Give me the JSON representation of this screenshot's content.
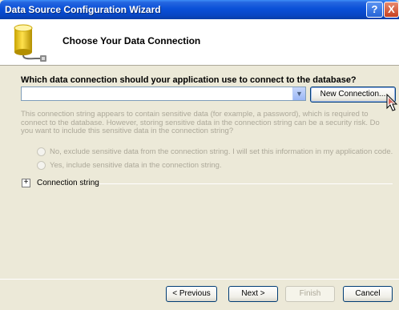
{
  "window": {
    "title": "Data Source Configuration Wizard"
  },
  "titlebar_buttons": {
    "help": "?",
    "close": "X"
  },
  "header": {
    "heading": "Choose Your Data Connection",
    "icon": "database-icon"
  },
  "question": "Which data connection should your application use to connect to the database?",
  "connection_combo": {
    "value": ""
  },
  "new_connection_button": "New Connection...",
  "description": "This connection string appears to contain sensitive data (for example, a password), which is required to connect to the database. However, storing sensitive data in the connection string can be a security risk. Do you want to include this sensitive data in the connection string?",
  "options": [
    {
      "label": "No, exclude sensitive data from the connection string. I will set this information in my application code.",
      "enabled": false
    },
    {
      "label": "Yes, include sensitive data in the connection string.",
      "enabled": false
    }
  ],
  "connection_string_section": {
    "expander": "+",
    "label": "Connection string"
  },
  "footer": {
    "previous": "< Previous",
    "next": "Next >",
    "finish": "Finish",
    "cancel": "Cancel"
  },
  "colors": {
    "titlebar": "#0a50d8",
    "dialog_bg": "#ece9d8",
    "disabled_text": "#aca899"
  }
}
